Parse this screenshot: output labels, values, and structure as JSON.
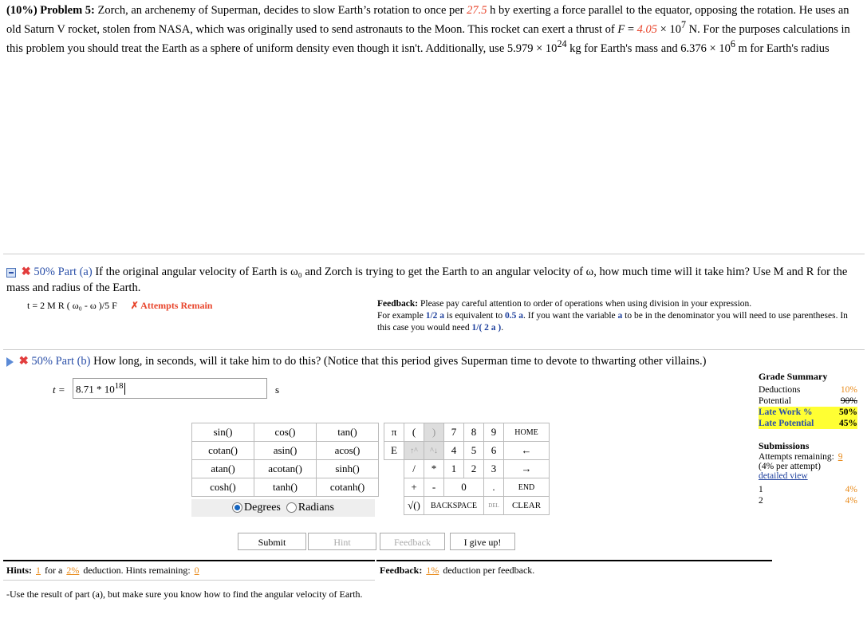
{
  "problem": {
    "header": "(10%) Problem 5:",
    "text1": "Zorch, an archenemy of Superman, decides to slow Earth’s rotation to once per",
    "period": "27.5",
    "text2": "h by exerting a force parallel to the equator, opposing the rotation. He uses an old Saturn V rocket, stolen from NASA, which was originally used to send astronauts to the Moon. This rocket can exert a thrust of",
    "force": "4.05",
    "text3": "N. For the purposes calculations in this problem you should treat the Earth as a sphere of uniform density even though it isn't. Additionally, use 5.979 × 10",
    "mass_exp": "24",
    "text4": "kg for Earth's mass and 6.376 × 10",
    "radius_exp": "6",
    "text5": "m for Earth's radius"
  },
  "part_a": {
    "header": "50% Part (a)",
    "question": "If the original angular velocity of Earth is ω₀ and Zorch is trying to get the Earth to an angular velocity of ω, how much time will it take him? Use M and R for the mass and radius of the Earth.",
    "answer": "t = 2 M R ( ω₀ - ω )/5 F",
    "status": "✗ Attempts Remain",
    "feedback_label": "Feedback:",
    "feedback_1": "Please pay careful attention to order of operations when using division in your expression.",
    "feedback_2": "For example",
    "ex1": "1/2 a",
    "feedback_3": "is equivalent to",
    "ex2": "0.5 a",
    "feedback_4": ". If you want the variable",
    "ex3": "a",
    "feedback_5": "to be in the denominator you will need to use parentheses. In this case you would need",
    "ex4": "1/( 2 a )",
    "feedback_6": "."
  },
  "part_b": {
    "header": "50% Part (b)",
    "question": "How long, in seconds, will it take him to do this? (Notice that this period gives Superman time to devote to thwarting other villains.)",
    "var_label": "t =",
    "input_value": "8.71 * 10",
    "input_exp": "18",
    "unit": "s"
  },
  "keypad": {
    "funcs": [
      [
        "sin()",
        "cos()",
        "tan()"
      ],
      [
        "cotan()",
        "asin()",
        "acos()"
      ],
      [
        "atan()",
        "acotan()",
        "sinh()"
      ],
      [
        "cosh()",
        "tanh()",
        "cotanh()"
      ]
    ],
    "row1": [
      "π",
      "(",
      ")",
      "7",
      "8",
      "9",
      "HOME"
    ],
    "row2": [
      "E",
      "↑^",
      "^↓",
      "4",
      "5",
      "6",
      "←"
    ],
    "row3": [
      "",
      "/",
      "*",
      "1",
      "2",
      "3",
      "→"
    ],
    "row4": [
      "+",
      "-",
      "0",
      ".",
      "END"
    ],
    "row5": [
      "√()",
      "BACKSPACE",
      "DEL",
      "CLEAR"
    ],
    "degrees": "Degrees",
    "radians": "Radians"
  },
  "buttons": {
    "submit": "Submit",
    "hint": "Hint",
    "feedback": "Feedback",
    "give_up": "I give up!"
  },
  "grade": {
    "title": "Grade Summary",
    "deductions_label": "Deductions",
    "deductions": "10%",
    "potential_label": "Potential",
    "potential": "90%",
    "late_work_label": "Late Work %",
    "late_work": "50%",
    "late_potential_label": "Late Potential",
    "late_potential": "45%",
    "submissions_title": "Submissions",
    "attempts_label": "Attempts remaining:",
    "attempts": "9",
    "per_attempt": "(4% per attempt)",
    "detail_link": "detailed view",
    "rows": [
      [
        "1",
        "4%"
      ],
      [
        "2",
        "4%"
      ]
    ]
  },
  "hints": {
    "label": "Hints:",
    "count": "1",
    "for_a": "for a",
    "pct": "2%",
    "deduction": "deduction. Hints remaining:",
    "remaining": "0",
    "text": "-Use the result of part (a), but make sure you know how to find the angular velocity of Earth."
  },
  "feedback_bar": {
    "label": "Feedback:",
    "pct": "1%",
    "text": "deduction per feedback."
  }
}
